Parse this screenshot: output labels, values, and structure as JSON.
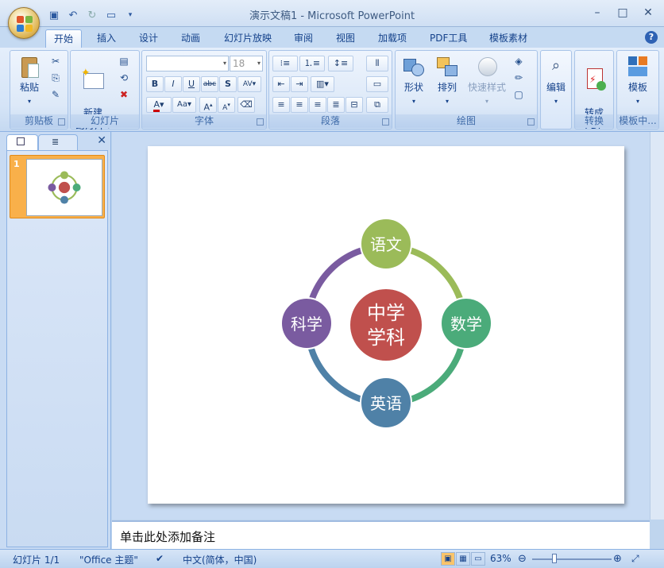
{
  "window": {
    "title": "演示文稿1 - Microsoft PowerPoint",
    "controls": [
      "minimize",
      "maximize",
      "close"
    ]
  },
  "tabs": [
    "开始",
    "插入",
    "设计",
    "动画",
    "幻灯片放映",
    "审阅",
    "视图",
    "加载项",
    "PDF工具",
    "模板素材"
  ],
  "ribbon": {
    "clipboard": {
      "label": "剪贴板",
      "paste": "粘贴"
    },
    "slides": {
      "label": "幻灯片",
      "new_slide": "新建\n幻灯片"
    },
    "font": {
      "label": "字体",
      "font_size": "18"
    },
    "paragraph": {
      "label": "段落"
    },
    "drawing": {
      "label": "绘图",
      "shapes": "形状",
      "arrange": "排列",
      "quick_styles": "快速样式"
    },
    "editing": {
      "label": "编辑"
    },
    "convert": {
      "label": "转换",
      "to_pdf": "转成\nPDF"
    },
    "template": {
      "label": "模板中...",
      "template": "模板"
    }
  },
  "slide_pane": {
    "slide_number": "1"
  },
  "slide": {
    "center": "中学\n学科",
    "nodes": [
      {
        "text": "语文",
        "color": "#9bbb59"
      },
      {
        "text": "数学",
        "color": "#4bab7a"
      },
      {
        "text": "英语",
        "color": "#4f81a7"
      },
      {
        "text": "科学",
        "color": "#7a5ba0"
      }
    ],
    "center_color": "#c0504d",
    "arc_colors": [
      "#9bbb59",
      "#4bab7a",
      "#4f81a7",
      "#7a5ba0"
    ]
  },
  "notes": {
    "placeholder": "单击此处添加备注"
  },
  "status": {
    "slide": "幻灯片 1/1",
    "theme": "\"Office 主题\"",
    "language": "中文(简体，中国)",
    "zoom": "63%"
  }
}
